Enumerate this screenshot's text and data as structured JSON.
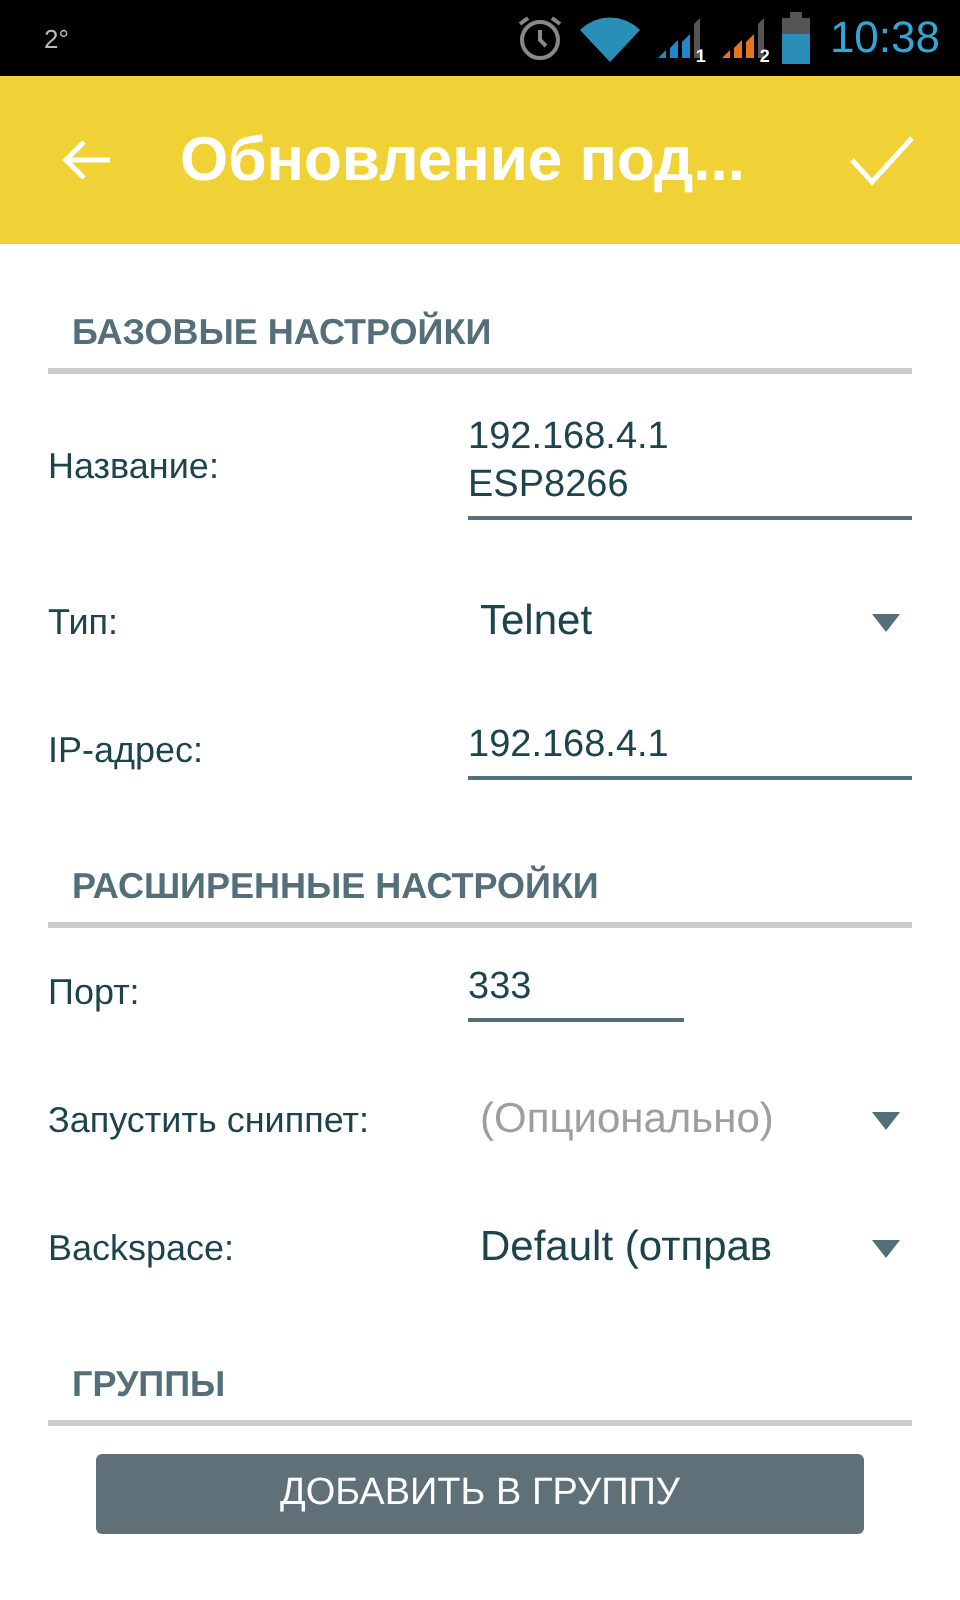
{
  "status_bar": {
    "temperature": "2°",
    "signals": [
      {
        "label": "1",
        "color": "#1e88c8"
      },
      {
        "label": "2",
        "color": "#e8731e"
      }
    ],
    "time": "10:38"
  },
  "toolbar": {
    "title": "Обновление под..."
  },
  "items": [
    {
      "kind": "header",
      "label": "БАЗОВЫЕ НАСТРОЙКИ"
    },
    {
      "kind": "text",
      "label": "Название:",
      "value": "192.168.4.1\nESP8266"
    },
    {
      "kind": "dropdown",
      "label": "Тип:",
      "value": "Telnet"
    },
    {
      "kind": "text",
      "label": "IP-адрес:",
      "value": "192.168.4.1"
    },
    {
      "kind": "header",
      "label": "РАСШИРЕННЫЕ НАСТРОЙКИ"
    },
    {
      "kind": "number",
      "label": "Порт:",
      "value": "333"
    },
    {
      "kind": "dropdown",
      "label": "Запустить сниппет:",
      "placeholder": "(Опционально)"
    },
    {
      "kind": "dropdown",
      "label": "Backspace:",
      "value": "Default (отправ"
    },
    {
      "kind": "header",
      "label": "ГРУППЫ"
    },
    {
      "kind": "button",
      "label": "ДОБАВИТЬ В ГРУППУ"
    }
  ]
}
